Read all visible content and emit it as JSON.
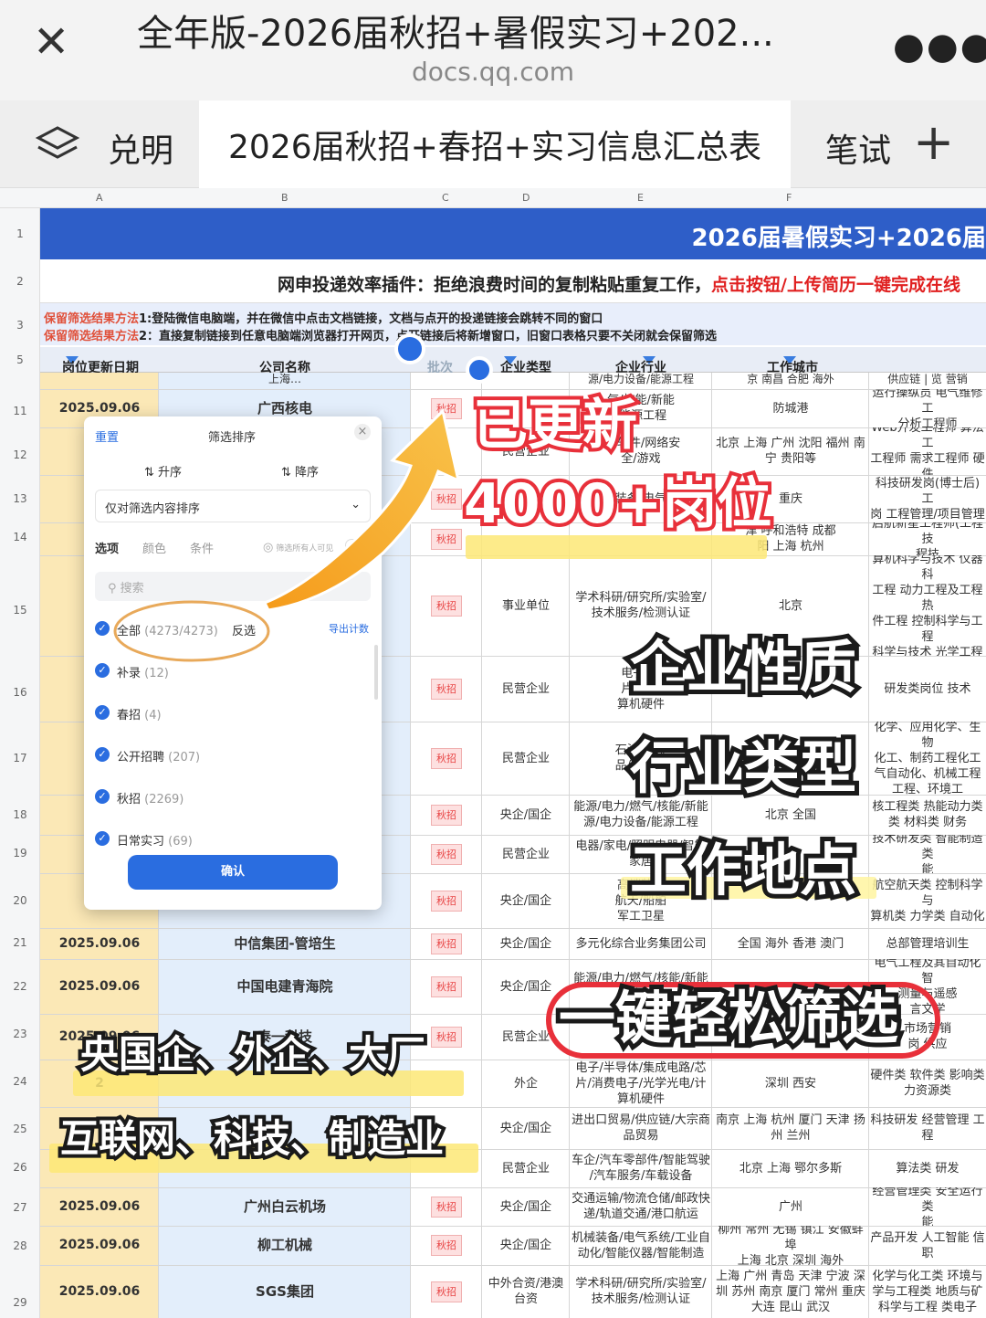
{
  "browser": {
    "title": "全年版-2026届秋招+暑假实习+202...",
    "url": "docs.qq.com"
  },
  "tabs": {
    "left": "兑明",
    "active": "2026届秋招+春招+实习信息汇总表",
    "right": "笔试"
  },
  "columns": [
    "A",
    "B",
    "C",
    "D",
    "E",
    "F"
  ],
  "row_numbers": [
    "1",
    "2",
    "3",
    "5",
    "11",
    "12",
    "13",
    "14",
    "15",
    "16",
    "17",
    "18",
    "19",
    "20",
    "21",
    "22",
    "23",
    "24",
    "25",
    "26",
    "27",
    "28",
    "29"
  ],
  "sheet": {
    "banner": "2026届暑假实习+2026届",
    "notice_prefix": "网申投递效率插件：拒绝浪费时间的复制粘贴重复工作，",
    "notice_red": "点击按钮/上传简历一键完成在线",
    "tip1_red": "保留筛选结果方法",
    "tip1_rest": "1:登陆微信电脑端，并在微信中点击文档链接，文档与点开的投递链接会跳转不同的窗口",
    "tip2_red": "保留筛选结果方法",
    "tip2_rest": "2：直接复制链接到任意电脑端浏览器打开网页，点开链接后将新增窗口，旧窗口表格只要不关闭就会保留筛选",
    "headers": [
      "岗位更新日期",
      "公司名称",
      "批次",
      "企业类型",
      "企业行业",
      "工作城市"
    ],
    "peek": {
      "comp": "上海…",
      "ind": "源/电力设备/能源工程",
      "city": "京 南昌 合肥 海外",
      "pos": "供应链 | 览 营销"
    },
    "rows": [
      {
        "date": "2025.09.06",
        "company": "广西核电",
        "batch": "秋招",
        "type": "",
        "industry": "气/核能/新能\n/能源工程",
        "city": "防城港",
        "positions": "运行操纵员 电气维修工\n分析工程师"
      },
      {
        "date": "20",
        "company": "",
        "batch": "",
        "type": "民营企业",
        "industry": "AI/软件/网络安\n全/游戏",
        "city": "北京 上海 广州 沈阳 福州 南\n宁 贵阳等",
        "positions": "Web开发工程师 算法工\n工程师 需求工程师 硬件"
      },
      {
        "date": "20",
        "company": "",
        "batch": "秋招",
        "type": "",
        "industry": "装备/电气",
        "city": "重庆",
        "positions": "科技研发岗(博士后) 工\n岗 工程管理/项目管理"
      },
      {
        "date": "20",
        "company": "",
        "batch": "秋招",
        "type": "",
        "industry": "",
        "city": "津 呼和浩特 成都\n阳 上海 杭州",
        "positions": "启航新星工程师(工程技\n程技"
      },
      {
        "date": "20",
        "company": "",
        "batch": "秋招",
        "type": "事业单位",
        "industry": "学术科研/研究所/实验室/\n技术服务/检测认证",
        "city": "北京",
        "positions": "人工智能 集成电路科学\n算机科学与技术 仪器科\n工程 动力工程及工程热\n件工程 控制科学与工程\n科学与技术 光学工程 软\n学 机械加工技术"
      },
      {
        "date": "20",
        "company": "",
        "batch": "秋招",
        "type": "民营企业",
        "industry": "电子/半\n片/消费\n算机硬件",
        "city": "海",
        "positions": "研发类岗位 技术"
      },
      {
        "date": "20",
        "company": "",
        "batch": "秋招",
        "type": "民营企业",
        "industry": "石油石化/\n品/化学工",
        "city": "",
        "positions": "化学、应用化学、生物\n化工、制药工程化工\n气自动化、机械工程\n工程、环境工"
      },
      {
        "date": "20",
        "company": "",
        "batch": "秋招",
        "type": "央企/国企",
        "industry": "能源/电力/燃气/核能/新能\n源/电力设备/能源工程",
        "city": "北京 全国",
        "positions": "核工程类 热能动力类\n类 材料类 财务"
      },
      {
        "date": "20",
        "company": "",
        "batch": "秋招",
        "type": "民营企业",
        "industry": "电器/家电/照明电器/智能\n家居",
        "city": "",
        "positions": "技术研发类 智能制造类\n能"
      },
      {
        "date": "20",
        "company": "",
        "batch": "秋招",
        "type": "央企/国企",
        "industry": "高端装备\n航天/船舶\n军工卫星",
        "city": "",
        "positions": "航空航天类 控制科学与\n算机类 力学类 自动化"
      },
      {
        "date": "2025.09.06",
        "company": "中信集团-管培生",
        "batch": "秋招",
        "type": "央企/国企",
        "industry": "多元化综合业务集团公司",
        "city": "全国 海外 香港 澳门",
        "positions": "总部管理培训生"
      },
      {
        "date": "2025.09.06",
        "company": "中国电建青海院",
        "batch": "秋招",
        "type": "央企/国企",
        "industry": "能源/电力/燃气/核能/新能\n源",
        "city": "",
        "positions": "电气工程及其自动化 智\n测量与遥感\n言文学"
      },
      {
        "date": "2025.09.06",
        "company": "泰一科技",
        "batch": "秋招",
        "type": "民营企业",
        "industry": "",
        "city": "",
        "positions": "市场营销\n岗 供应"
      },
      {
        "date": "2",
        "company": "",
        "batch": "",
        "type": "外企",
        "industry": "电子/半导体/集成电路/芯\n片/消费电子/光学光电/计\n算机硬件",
        "city": "深圳 西安",
        "positions": "硬件类 软件类 影响类\n力资源类"
      },
      {
        "date": "",
        "company": "",
        "batch": "",
        "type": "央企/国企",
        "industry": "进出口贸易/供应链/大宗商\n品贸易",
        "city": "南京 上海 杭州 厦门 天津 扬\n州 兰州",
        "positions": "科技研发 经营管理 工程"
      },
      {
        "date": "",
        "company": "",
        "batch": "",
        "type": "民营企业",
        "industry": "车企/汽车零部件/智能驾驶\n/汽车服务/车载设备",
        "city": "北京 上海 鄂尔多斯",
        "positions": "算法类 研发"
      },
      {
        "date": "2025.09.06",
        "company": "广州白云机场",
        "batch": "秋招",
        "type": "央企/国企",
        "industry": "交通运输/物流仓储/邮政快\n递/轨道交通/港口航运",
        "city": "广州",
        "positions": "经营管理类 安全运行类\n能"
      },
      {
        "date": "2025.09.06",
        "company": "柳工机械",
        "batch": "秋招",
        "type": "央企/国企",
        "industry": "机械装备/电气系统/工业自\n动化/智能仪器/智能制造",
        "city": "柳州 常州 无锡 镇江 安徽蚌埠\n上海 北京 深圳 海外",
        "positions": "产品开发 人工智能 信\n职"
      },
      {
        "date": "2025.09.06",
        "company": "SGS集团",
        "batch": "秋招",
        "type": "中外合资/港澳\n台资",
        "industry": "学术科研/研究所/实验室/\n技术服务/检测认证",
        "city": "上海 广州 青岛 天津 宁波 深\n圳 苏州 南京 厦门 常州 重庆\n大连 昆山 武汉",
        "positions": "化学与化工类 环境与\n学与工程类 地质与矿\n科学与工程 类电子"
      }
    ]
  },
  "filter_panel": {
    "title": "筛选排序",
    "reset": "重置",
    "asc": "升序",
    "desc": "降序",
    "scope": "仅对筛选内容排序",
    "tabs": [
      "选项",
      "颜色",
      "条件"
    ],
    "visibility": "筛选所有人可见",
    "search_placeholder": "搜索",
    "all_label": "全部",
    "all_count": "(4273/4273)",
    "invert": "反选",
    "export": "导出计数",
    "options": [
      {
        "label": "补录",
        "count": "(12)"
      },
      {
        "label": "春招",
        "count": "(4)"
      },
      {
        "label": "公开招聘",
        "count": "(207)"
      },
      {
        "label": "秋招",
        "count": "(2269)"
      },
      {
        "label": "日常实习",
        "count": "(69)"
      }
    ],
    "confirm": "确认"
  },
  "overlay": {
    "updated": "已更新",
    "count": "4000+岗位",
    "nature": "企业性质",
    "industry_type": "行业类型",
    "location": "工作地点",
    "one_click": "一键轻松筛选",
    "left1": "央国企、外企、大厂",
    "left2": "互联网、科技、制造业"
  },
  "colors": {
    "banner": "#2e5ec8",
    "date_col": "#fbe8b6",
    "company_col": "#e3eefb",
    "accent": "#2a6de0",
    "arrow": "#f5a623",
    "red": "#e02020"
  }
}
